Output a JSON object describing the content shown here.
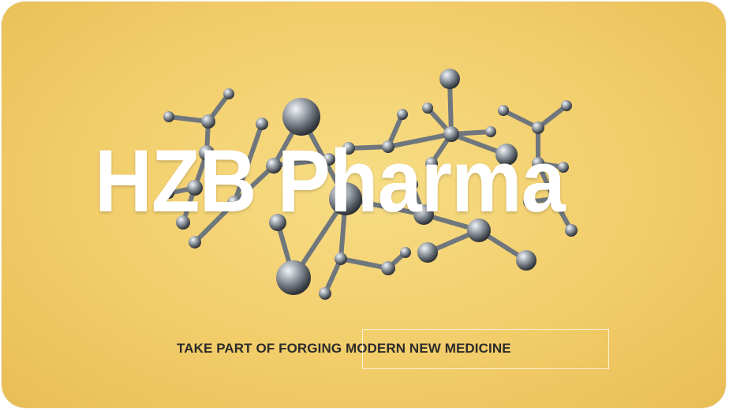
{
  "banner": {
    "brand_name": "HZB Pharma",
    "tagline": "TAKE PART OF FORGING MODERN NEW MEDICINE",
    "background_color": "#f2cd6a",
    "text_color": "#ffffff",
    "tagline_color": "#2b2b2b",
    "illustration": "molecule-structure-icon"
  }
}
